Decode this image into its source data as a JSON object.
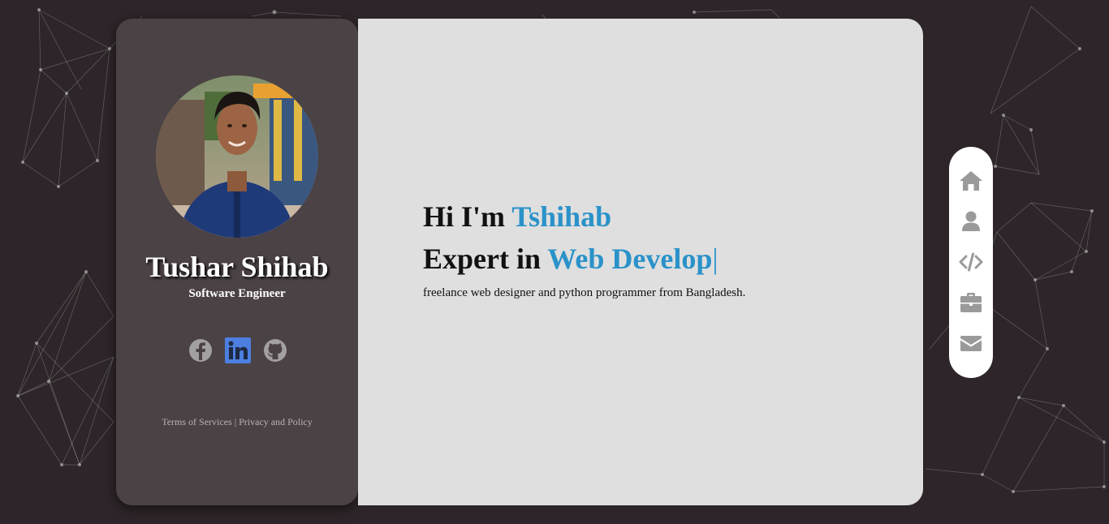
{
  "profile": {
    "name": "Tushar Shihab",
    "role": "Software Engineer",
    "socials": [
      {
        "icon": "facebook-icon"
      },
      {
        "icon": "linkedin-icon",
        "color": "#4d7fe0"
      },
      {
        "icon": "github-icon"
      }
    ],
    "footer": {
      "terms": "Terms of Services",
      "separator": "|",
      "privacy": "Privacy and Policy"
    }
  },
  "hero": {
    "greeting_prefix": "Hi I'm",
    "greeting_name": "Tshihab",
    "expert_prefix": "Expert in",
    "expert_typed": "Web Develop",
    "cursor": "|",
    "description": "freelance web designer and python programmer from Bangladesh."
  },
  "nav": [
    {
      "icon": "home-icon"
    },
    {
      "icon": "user-icon"
    },
    {
      "icon": "code-icon"
    },
    {
      "icon": "briefcase-icon"
    },
    {
      "icon": "envelope-icon"
    }
  ],
  "colors": {
    "background": "#2d2529",
    "profile_card": "#4b4245",
    "main_card": "#dfdfdf",
    "accent": "#2b92c9",
    "icon_gray": "#9a9a9a"
  }
}
